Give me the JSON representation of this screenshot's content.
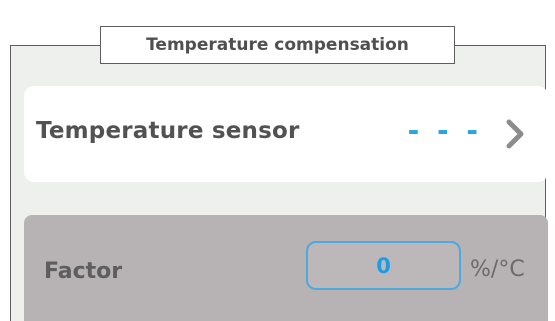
{
  "group": {
    "title": "Temperature compensation"
  },
  "temperature_sensor": {
    "label": "Temperature sensor",
    "value": "- - -"
  },
  "factor": {
    "label": "Factor",
    "value": "0",
    "unit": "%/°C"
  },
  "colors": {
    "accent": "#29a3e3",
    "panel_background": "#eef0ed",
    "disabled_row": "#b7b2b3",
    "text": "#525252"
  },
  "icons": {
    "sensor_row": "chevron-right-icon"
  }
}
